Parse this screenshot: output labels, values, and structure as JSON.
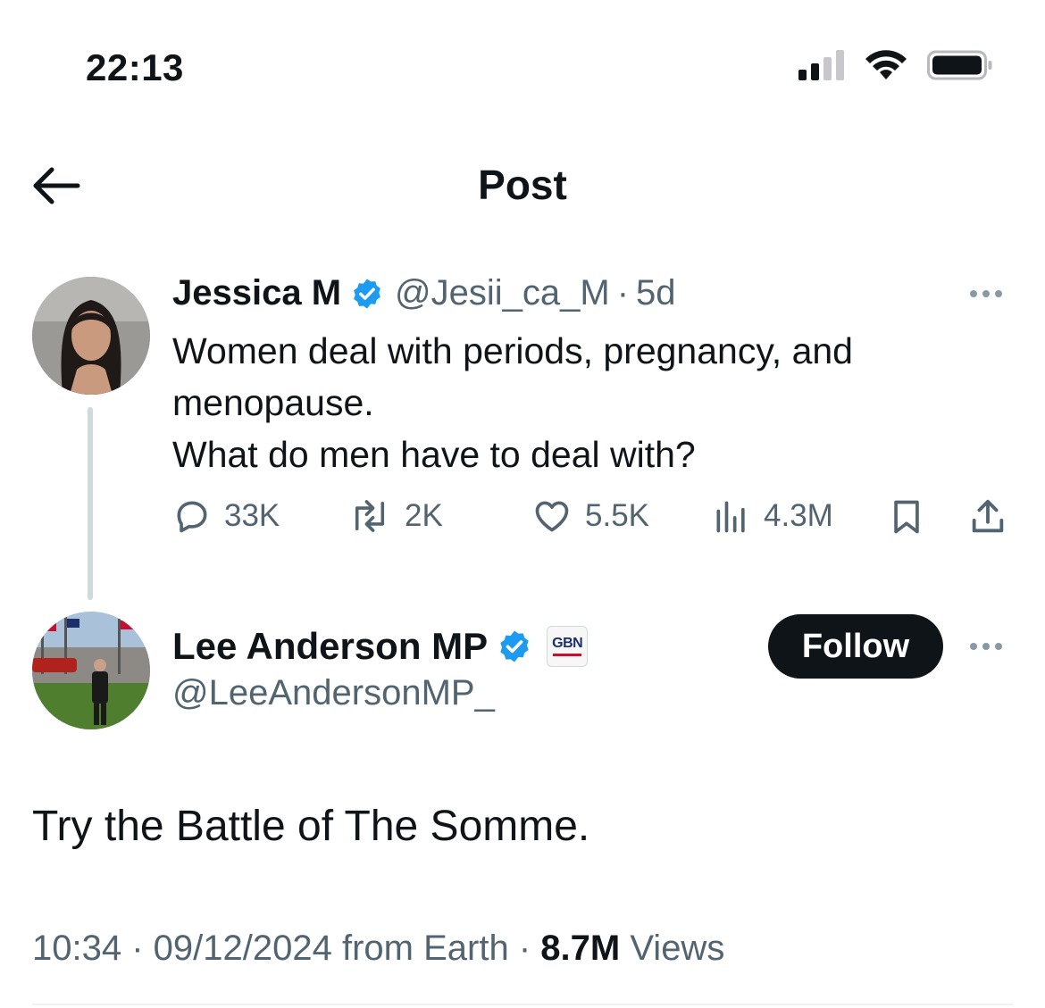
{
  "status_bar": {
    "time": "22:13",
    "icons": [
      "cellular-signal-icon",
      "wifi-icon",
      "battery-icon"
    ]
  },
  "header": {
    "title": "Post",
    "back_icon": "back-arrow-icon"
  },
  "tweet_original": {
    "name": "Jessica M",
    "verified": true,
    "handle": "@Jesii_ca_M",
    "separator": "·",
    "age": "5d",
    "text_line1": "Women deal with periods, pregnancy, and menopause.",
    "text_line2": "What do men have to deal with?",
    "replies": "33K",
    "reposts": "2K",
    "likes": "5.5K",
    "views": "4.3M"
  },
  "tweet_reply": {
    "name": "Lee Anderson MP",
    "verified": true,
    "affiliation_badge": "GBN",
    "handle": "@LeeAndersonMP_",
    "follow_label": "Follow",
    "text": "Try the Battle of The Somme.",
    "time": "10:34",
    "date": "09/12/2024",
    "source": "from Earth",
    "views_count": "8.7M",
    "views_label": "Views"
  },
  "colors": {
    "text_primary": "#0f1419",
    "text_secondary": "#536471",
    "verified_blue": "#1d9bf0",
    "follow_button": "#0f1419"
  }
}
